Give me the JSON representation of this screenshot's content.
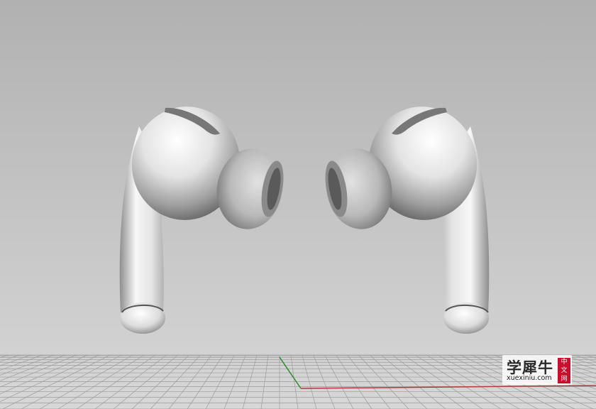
{
  "scene": {
    "background_top": "#b2b2b2",
    "background_bottom": "#d6d6d6",
    "grid_color": "#9c9c9c",
    "x_axis_color": "#b23a3a",
    "y_axis_color": "#2e8b2e",
    "objects": [
      "earbud-left",
      "earbud-right"
    ]
  },
  "watermark": {
    "title": "学犀牛",
    "url": "xuexiniu.com",
    "badge": [
      "中",
      "文",
      "网"
    ]
  }
}
